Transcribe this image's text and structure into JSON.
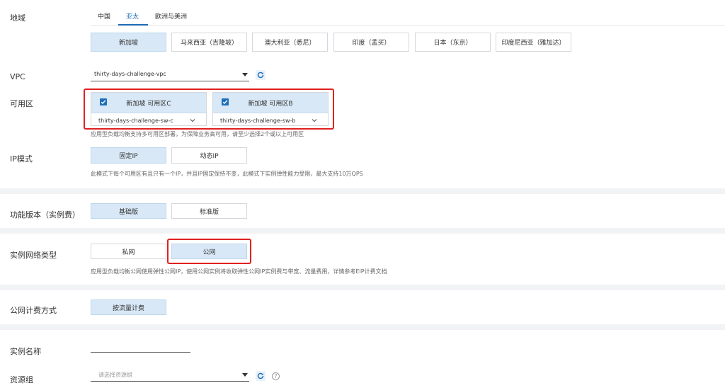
{
  "region": {
    "label": "地域",
    "tabs": [
      "中国",
      "亚太",
      "欧洲与美洲"
    ],
    "active_tab": "亚太",
    "options": [
      "新加坡",
      "马来西亚（吉隆坡）",
      "澳大利亚（悉尼）",
      "印度（孟买）",
      "日本（东京）",
      "印度尼西亚（雅加达）"
    ],
    "selected": "新加坡"
  },
  "vpc": {
    "label": "VPC",
    "value": "thirty-days-challenge-vpc"
  },
  "zones": {
    "label": "可用区",
    "cards": [
      {
        "title": "新加坡 可用区C",
        "vswitch": "thirty-days-challenge-sw-c"
      },
      {
        "title": "新加坡 可用区B",
        "vswitch": "thirty-days-challenge-sw-b"
      }
    ],
    "hint": "应用型负载均衡支持多可用区部署，为保障业务高可用，请至少选择2个或以上可用区"
  },
  "ip_mode": {
    "label": "IP模式",
    "options": [
      "固定IP",
      "动态IP"
    ],
    "selected": "固定IP",
    "hint": "此模式下每个可用区有且只有一个IP，并且IP固定保持不变，此模式下实例弹性能力受限，最大支持10万QPS"
  },
  "edition": {
    "label": "功能版本（实例费）",
    "options": [
      "基础版",
      "标准版"
    ],
    "selected": "基础版"
  },
  "network_type": {
    "label": "实例网络类型",
    "options": [
      "私网",
      "公网"
    ],
    "selected": "公网",
    "hint": "应用型负载均衡公网使用弹性公网IP，使用公网实例将收取弹性公网IP实例费与带宽、流量费用，详情参考EIP计费文档"
  },
  "billing": {
    "label": "公网计费方式",
    "options": [
      "按流量计费"
    ],
    "selected": "按流量计费"
  },
  "instance_name": {
    "label": "实例名称",
    "value": ""
  },
  "resource_group": {
    "label": "资源组",
    "placeholder": "请选择资源组"
  },
  "colors": {
    "accent": "#1e6fba",
    "selected_bg": "#d8e8f6",
    "highlight": "#e02020"
  }
}
